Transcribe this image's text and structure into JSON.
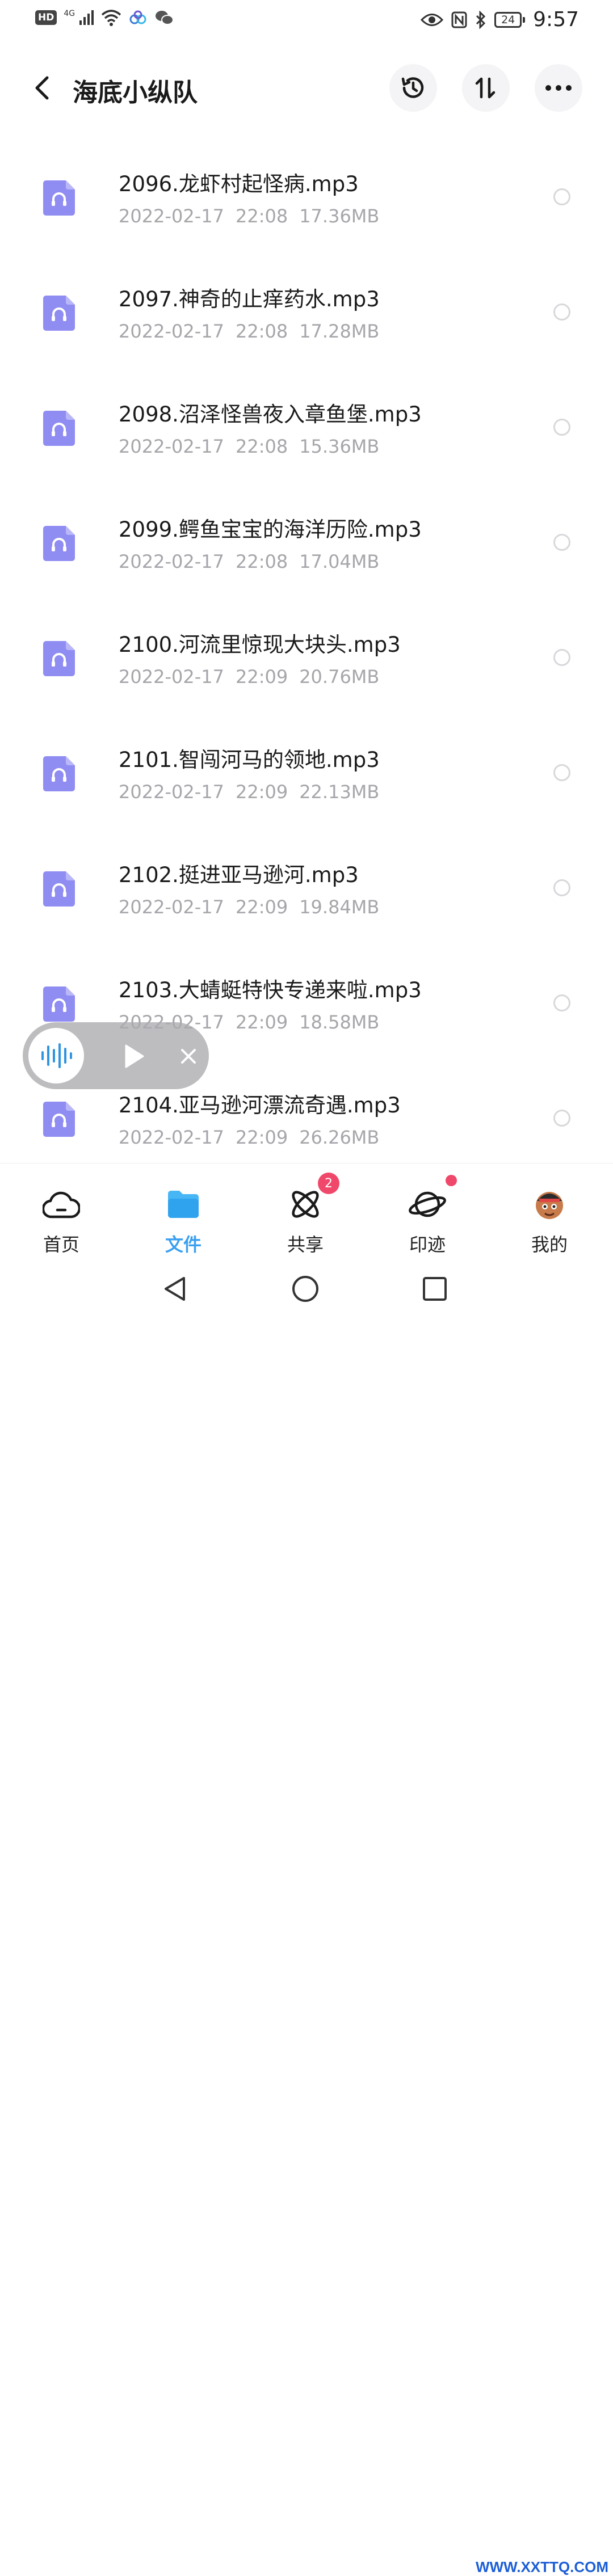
{
  "status_bar": {
    "hd": "HD",
    "network": "4G",
    "time": "9:57",
    "battery": "24"
  },
  "header": {
    "title": "海底小纵队"
  },
  "files": [
    {
      "name": "2096.龙虾村起怪病.mp3",
      "date": "2022-02-17",
      "time": "22:08",
      "size": "17.36MB"
    },
    {
      "name": "2097.神奇的止痒药水.mp3",
      "date": "2022-02-17",
      "time": "22:08",
      "size": "17.28MB"
    },
    {
      "name": "2098.沼泽怪兽夜入章鱼堡.mp3",
      "date": "2022-02-17",
      "time": "22:08",
      "size": "15.36MB"
    },
    {
      "name": "2099.鳄鱼宝宝的海洋历险.mp3",
      "date": "2022-02-17",
      "time": "22:08",
      "size": "17.04MB"
    },
    {
      "name": "2100.河流里惊现大块头.mp3",
      "date": "2022-02-17",
      "time": "22:09",
      "size": "20.76MB"
    },
    {
      "name": "2101.智闯河马的领地.mp3",
      "date": "2022-02-17",
      "time": "22:09",
      "size": "22.13MB"
    },
    {
      "name": "2102.挺进亚马逊河.mp3",
      "date": "2022-02-17",
      "time": "22:09",
      "size": "19.84MB"
    },
    {
      "name": "2103.大蜻蜓特快专递来啦.mp3",
      "date": "2022-02-17",
      "time": "22:09",
      "size": "18.58MB"
    },
    {
      "name": "2104.亚马逊河漂流奇遇.mp3",
      "date": "2022-02-17",
      "time": "22:09",
      "size": "26.26MB"
    }
  ],
  "bottom_nav": {
    "items": [
      {
        "label": "首页",
        "icon": "cloud-home-icon"
      },
      {
        "label": "文件",
        "icon": "folder-icon"
      },
      {
        "label": "共享",
        "icon": "share-atom-icon",
        "badge": "2"
      },
      {
        "label": "印迹",
        "icon": "planet-icon"
      },
      {
        "label": "我的",
        "icon": "avatar-icon"
      }
    ]
  },
  "watermark": "WWW.XXTTQ.COM",
  "colors": {
    "accent": "#3aa0f0",
    "file_icon": "#8f8cf2",
    "badge": "#f0486a"
  }
}
